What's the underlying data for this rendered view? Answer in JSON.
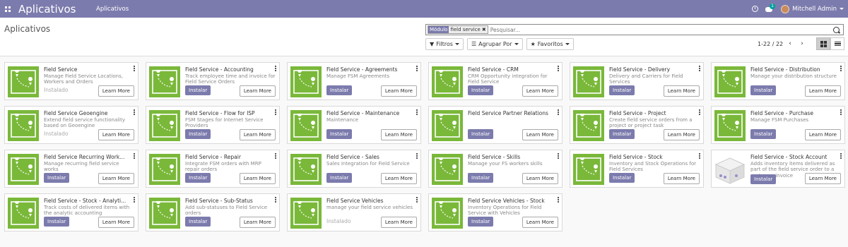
{
  "navbar": {
    "brand": "Aplicativos",
    "menu": "Aplicativos",
    "chat_count": "1",
    "user_name": "Mitchell Admin"
  },
  "control": {
    "title": "Aplicativos",
    "facet_label": "Módulo",
    "facet_value": "field service",
    "search_placeholder": "Pesquisar...",
    "filters_label": "Filtros",
    "group_by_label": "Agrupar Por",
    "favorites_label": "Favoritos",
    "pager": "1-22 / 22"
  },
  "labels": {
    "install": "Instalar",
    "installed": "Instalado",
    "learn_more": "Learn More"
  },
  "colors": {
    "brand": "#7c7bad",
    "tile_green": "#7ab83a"
  },
  "apps": [
    {
      "name": "Field Service",
      "desc": "Manage Field Service Locations, Workers and Orders",
      "installed": true,
      "icon": "field-service-map"
    },
    {
      "name": "Field Service - Accounting",
      "desc": "Track employee time and invoice for Field Service Orders",
      "installed": false,
      "icon": "field-service-map"
    },
    {
      "name": "Field Service - Agreements",
      "desc": "Manage FSM Agreements",
      "installed": false,
      "icon": "field-service-map"
    },
    {
      "name": "Field Service - CRM",
      "desc": "CRM Opportunity integration for Field Service",
      "installed": false,
      "icon": "field-service-map"
    },
    {
      "name": "Field Service - Delivery",
      "desc": "Delivery and Carriers for Field Services",
      "installed": false,
      "icon": "field-service-map"
    },
    {
      "name": "Field Service - Distribution",
      "desc": "Manage your distribution structure",
      "installed": false,
      "icon": "field-service-map"
    },
    {
      "name": "Field Service Geoengine",
      "desc": "Extend field service functionality based on Geoengine",
      "installed": true,
      "icon": "field-service-map"
    },
    {
      "name": "Field Service - Flow for ISP",
      "desc": "FSM Stages for Internet Service Providers",
      "installed": false,
      "icon": "field-service-map"
    },
    {
      "name": "Field Service - Maintenance",
      "desc": "Maintenance",
      "installed": false,
      "icon": "field-service-map"
    },
    {
      "name": "Field Service Partner Relations",
      "desc": "",
      "installed": false,
      "icon": "field-service-map"
    },
    {
      "name": "Field Service - Project",
      "desc": "Create field service orders from a project or project task",
      "installed": false,
      "icon": "field-service-map"
    },
    {
      "name": "Field Service - Purchase",
      "desc": "Manage FSM Purchases",
      "installed": false,
      "icon": "field-service-map"
    },
    {
      "name": "Field Service Recurring Work...",
      "desc": "Manage recurring field service works",
      "installed": false,
      "icon": "field-service-map"
    },
    {
      "name": "Field Service - Repair",
      "desc": "Integrate FSM orders with MRP repair orders",
      "installed": false,
      "icon": "field-service-map"
    },
    {
      "name": "Field Service - Sales",
      "desc": "Sales integration for Field Service",
      "installed": false,
      "icon": "field-service-map"
    },
    {
      "name": "Field Service - Skills",
      "desc": "Manage your FS workers skills",
      "installed": false,
      "icon": "field-service-map"
    },
    {
      "name": "Field Service - Stock",
      "desc": "Inventory and Stock Operations for Field Services",
      "installed": false,
      "icon": "field-service-map"
    },
    {
      "name": "Field Service - Stock Account",
      "desc": "Adds inventory items delivered as part of the field service order to a customer invoice",
      "installed": false,
      "icon": "stock-account-tile"
    },
    {
      "name": "Field Service - Stock - Analyti...",
      "desc": "Track costs of delivered items with the analytic accounting",
      "installed": false,
      "icon": "field-service-map"
    },
    {
      "name": "Field Service - Sub-Status",
      "desc": "Add sub-statuses to Field Service orders",
      "installed": false,
      "icon": "field-service-map"
    },
    {
      "name": "Field Service Vehicles",
      "desc": "manage your field service vehicles",
      "installed": true,
      "icon": "field-service-map"
    },
    {
      "name": "Field Service Vehicles - Stock",
      "desc": "Inventory Operations for Field Service with Vehicles",
      "installed": false,
      "icon": "field-service-map"
    }
  ]
}
